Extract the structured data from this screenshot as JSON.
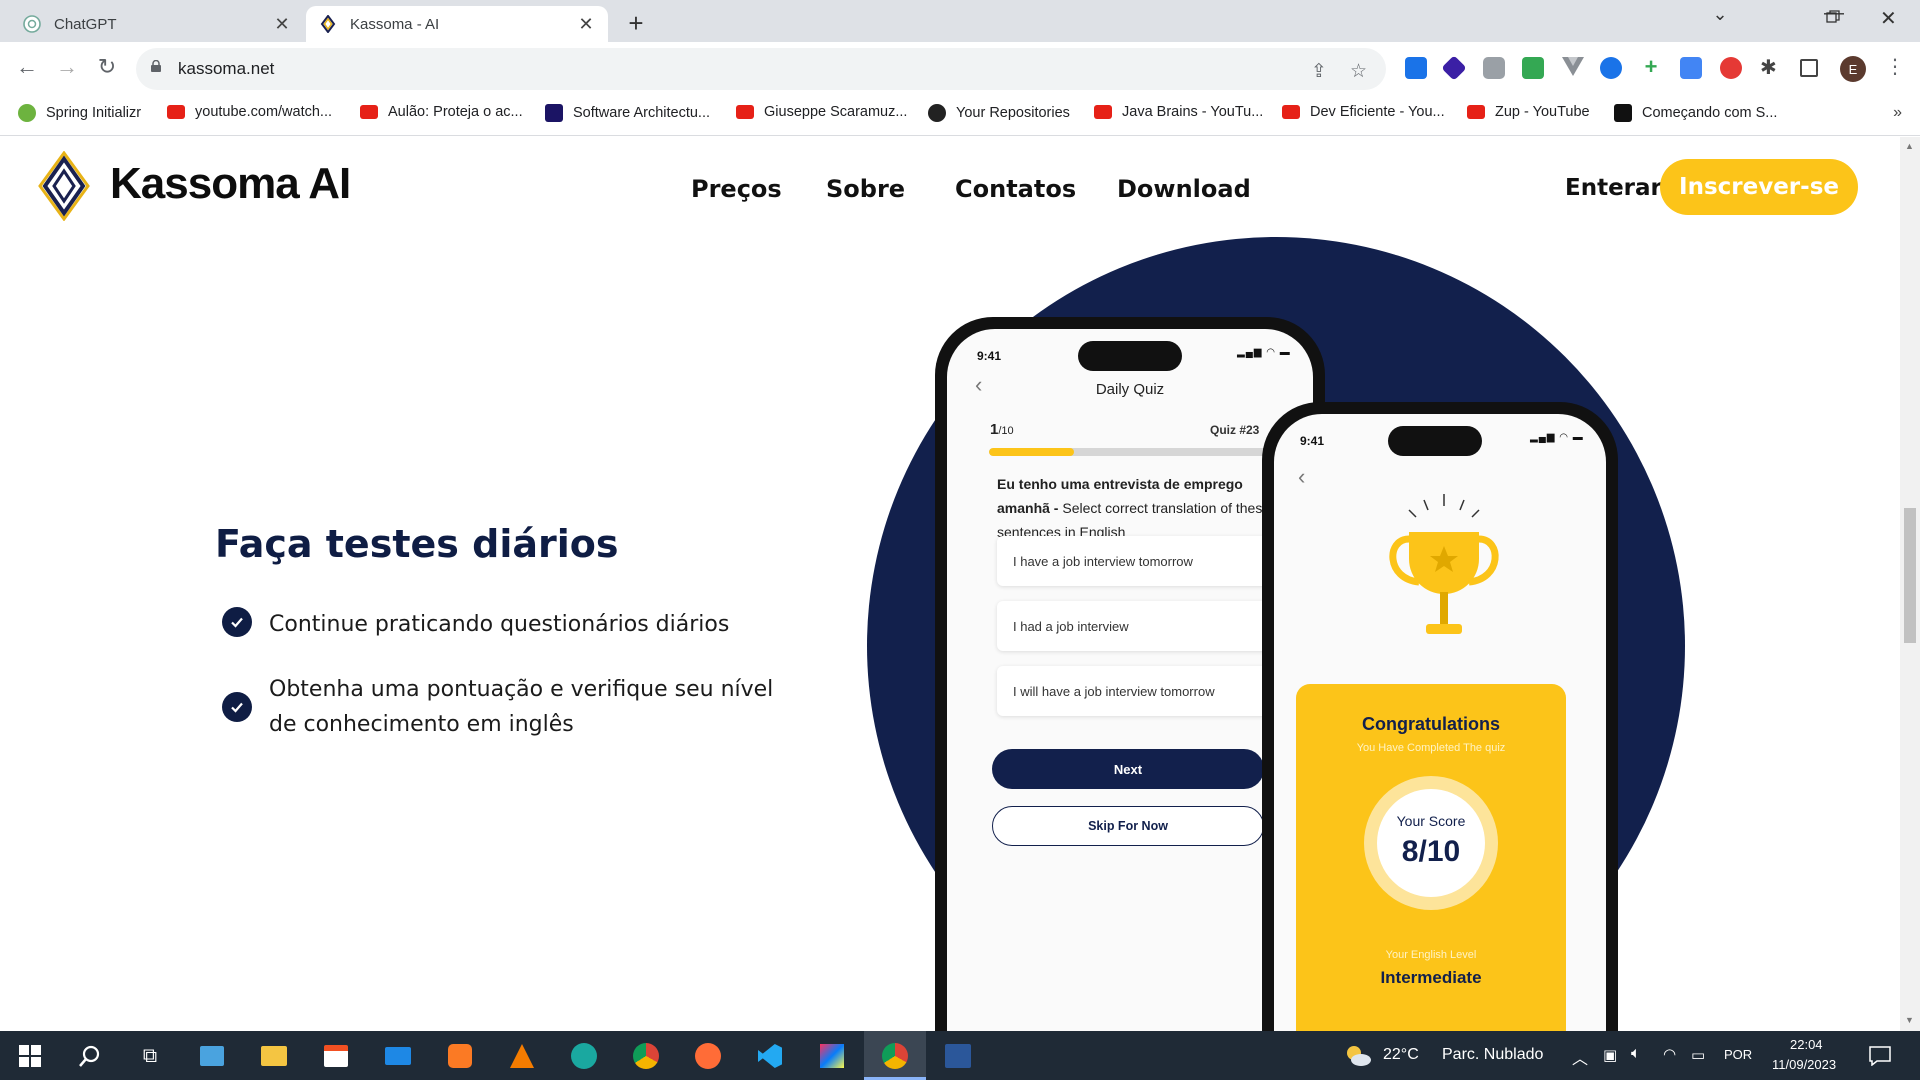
{
  "browser": {
    "tabs": [
      {
        "title": "ChatGPT",
        "active": false,
        "favicon": "chatgpt-icon"
      },
      {
        "title": "Kassoma - AI",
        "active": true,
        "favicon": "kassoma-logo-icon"
      }
    ],
    "url": "kassoma.net",
    "profile_initial": "E",
    "bookmarks": [
      {
        "label": "Spring Initializr",
        "icon": "spring-icon"
      },
      {
        "label": "youtube.com/watch...",
        "icon": "youtube-icon"
      },
      {
        "label": "Aulão: Proteja o ac...",
        "icon": "youtube-icon"
      },
      {
        "label": "Software Architectu...",
        "icon": "f-icon"
      },
      {
        "label": "Giuseppe Scaramuz...",
        "icon": "youtube-icon"
      },
      {
        "label": "Your Repositories",
        "icon": "github-icon"
      },
      {
        "label": "Java Brains - YouTu...",
        "icon": "youtube-icon"
      },
      {
        "label": "Dev Eficiente - You...",
        "icon": "youtube-icon"
      },
      {
        "label": "Zup - YouTube",
        "icon": "youtube-icon"
      },
      {
        "label": "Começando com S...",
        "icon": "medium-icon"
      }
    ],
    "bookmarks_more": "»"
  },
  "site": {
    "brand": "Kassoma AI",
    "nav": [
      "Preços",
      "Sobre",
      "Contatos",
      "Download"
    ],
    "login": "Enterar",
    "signup": "Inscrever-se",
    "accent_color": "#fcc419",
    "navy_color": "#12204c"
  },
  "section": {
    "heading": "Faça testes diários",
    "features": [
      "Continue praticando questionários diários",
      "Obtenha uma pontuação e verifique seu nível de conhecimento em inglês"
    ]
  },
  "quiz_phone": {
    "time": "9:41",
    "title": "Daily Quiz",
    "progress_current": "1",
    "progress_total": "/10",
    "quiz_number": "Quiz #23",
    "progress_fraction": 0.1,
    "question_bold": "Eu tenho uma entrevista de emprego amanhã - ",
    "question_rest": "Select  correct translation of these sentences in English",
    "options": [
      "I have a job interview tomorrow",
      "I had a job interview",
      "I will have a job interview tomorrow"
    ],
    "next": "Next",
    "skip": "Skip For Now"
  },
  "result_phone": {
    "time": "9:41",
    "congrats": "Congratulations",
    "completed": "You Have Completed The quiz",
    "score_label": "Your Score",
    "score": "8/10",
    "level_label": "Your English Level",
    "level": "Intermediate"
  },
  "taskbar": {
    "weather_temp": "22°C",
    "weather_desc": "Parc. Nublado",
    "language": "POR",
    "time": "22:04",
    "date": "11/09/2023"
  }
}
